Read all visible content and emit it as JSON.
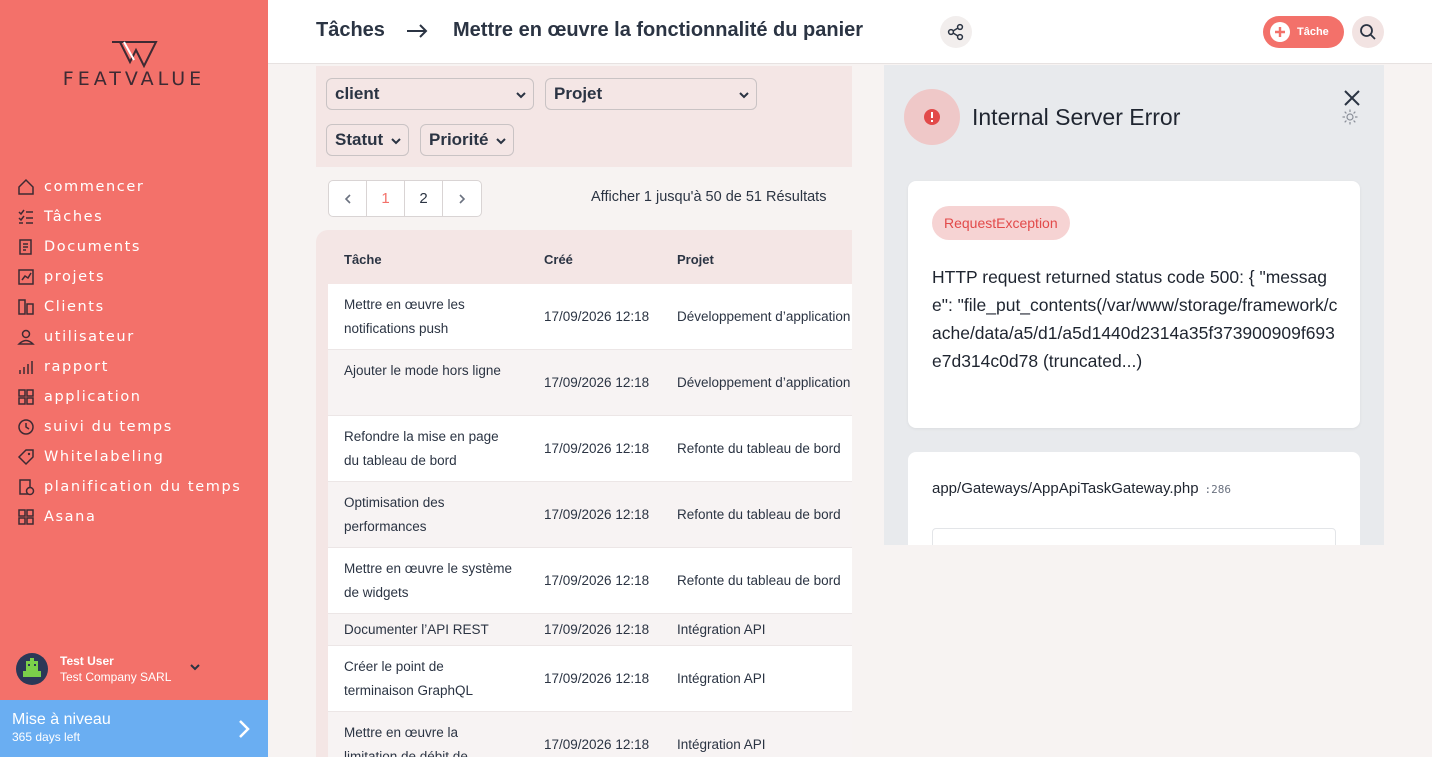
{
  "brand": {
    "logo_text": "FEATVALUE"
  },
  "colors": {
    "sidebar": "#f3716a",
    "accent": "#f3716a",
    "upgrade": "#6aaef2",
    "error": "#e24a4a"
  },
  "sidebar": {
    "items": [
      {
        "label": "commencer",
        "icon": "home-icon"
      },
      {
        "label": "Tâches",
        "icon": "tasks-icon"
      },
      {
        "label": "Documents",
        "icon": "documents-icon"
      },
      {
        "label": "projets",
        "icon": "projects-icon"
      },
      {
        "label": "Clients",
        "icon": "clients-icon"
      },
      {
        "label": "utilisateur",
        "icon": "user-icon"
      },
      {
        "label": "rapport",
        "icon": "report-icon"
      },
      {
        "label": "application",
        "icon": "apps-icon"
      },
      {
        "label": "suivi du temps",
        "icon": "time-tracking-icon"
      },
      {
        "label": "Whitelabeling",
        "icon": "whitelabel-icon"
      },
      {
        "label": "planification du temps",
        "icon": "time-planning-icon"
      },
      {
        "label": "Asana",
        "icon": "asana-icon"
      }
    ],
    "user": {
      "name": "Test User",
      "company": "Test Company SARL"
    },
    "upgrade": {
      "title": "Mise à niveau",
      "subtitle": "365 days left"
    }
  },
  "header": {
    "breadcrumb_root": "Tâches",
    "breadcrumb_current": "Mettre en œuvre la fonctionnalité du panier",
    "new_task_label": "Tâche"
  },
  "filters": {
    "client": "client",
    "project": "Projet",
    "status": "Statut",
    "priority": "Priorité"
  },
  "pagination": {
    "pages": [
      "1",
      "2"
    ],
    "current": "1",
    "summary": "Afficher 1 jusqu'à 50 de 51 Résultats"
  },
  "table": {
    "columns": [
      "Tâche",
      "Créé",
      "Projet"
    ],
    "rows": [
      {
        "task": "Mettre en œuvre les notifications push",
        "created": "17/09/2026 12:18",
        "project": "Développement d’application mobile"
      },
      {
        "task": "Ajouter le mode hors ligne",
        "created": "17/09/2026 12:18",
        "project": "Développement d’application mobile"
      },
      {
        "task": "Refondre la mise en page du tableau de bord",
        "created": "17/09/2026 12:18",
        "project": "Refonte du tableau de bord"
      },
      {
        "task": "Optimisation des performances",
        "created": "17/09/2026 12:18",
        "project": "Refonte du tableau de bord"
      },
      {
        "task": "Mettre en œuvre le système de widgets",
        "created": "17/09/2026 12:18",
        "project": "Refonte du tableau de bord"
      },
      {
        "task": "Documenter l’API REST",
        "created": "17/09/2026 12:18",
        "project": "Intégration API"
      },
      {
        "task": "Créer le point de terminaison GraphQL",
        "created": "17/09/2026 12:18",
        "project": "Intégration API"
      },
      {
        "task": "Mettre en œuvre la limitation de débit de",
        "created": "17/09/2026 12:18",
        "project": "Intégration API"
      }
    ]
  },
  "error": {
    "title": "Internal Server Error",
    "exception": "RequestException",
    "message": "HTTP request returned status code 500: { \"message\": \"file_put_contents(/var/www/storage/framework/cache/data/a5/d1/a5d1440d2314a35f373900909f693e7d314c0d78 (truncated...)",
    "frame_path": "app/Gateways/AppApiTaskGateway.php",
    "frame_line": ":286"
  }
}
